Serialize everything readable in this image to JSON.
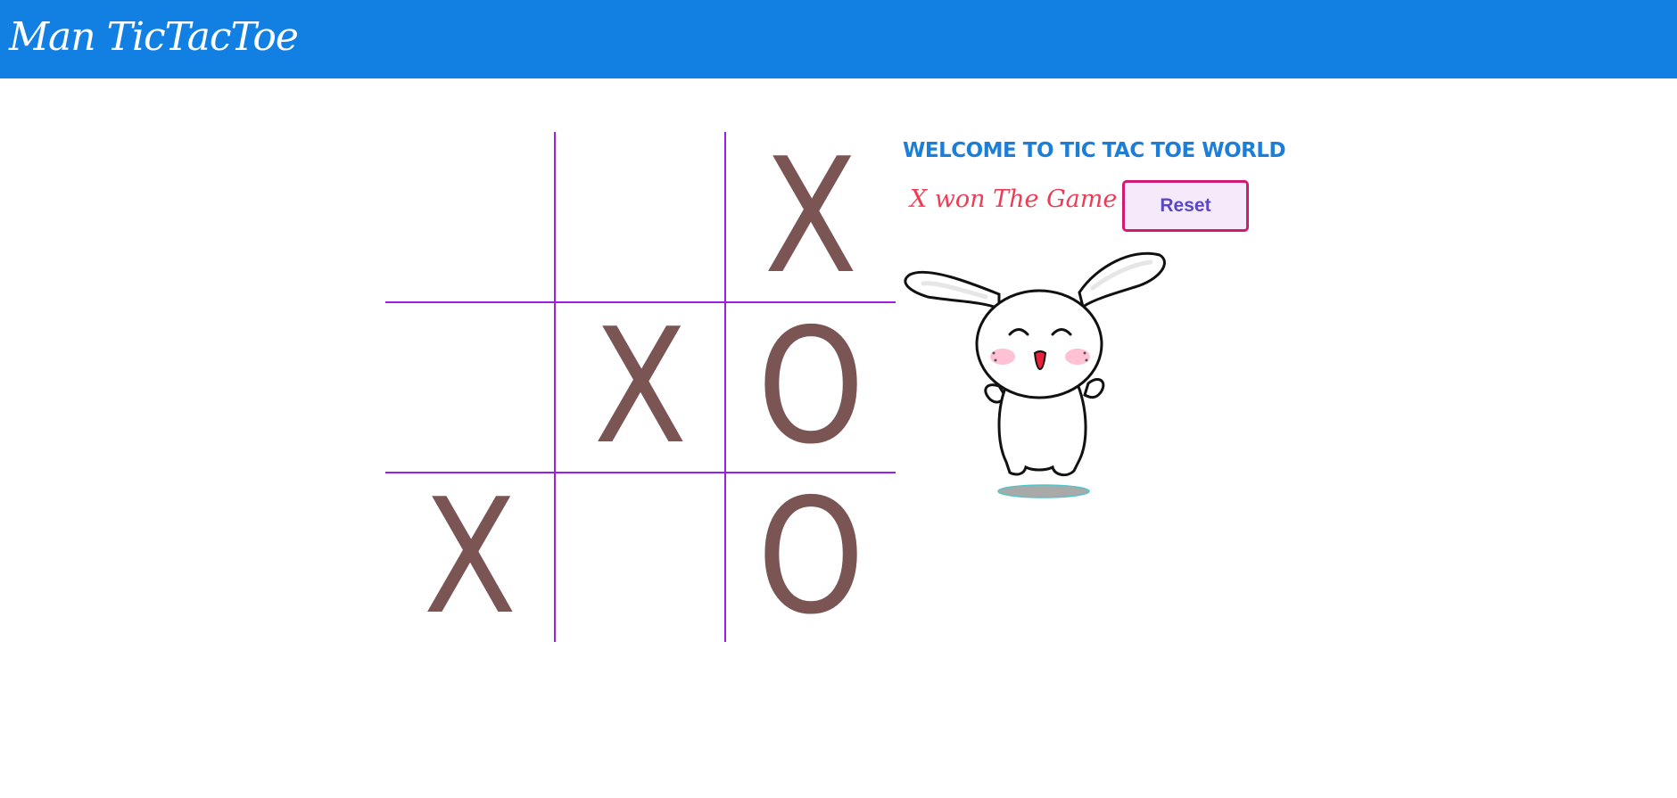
{
  "header": {
    "brand": "Man TicTacToe"
  },
  "board": {
    "cells": [
      {
        "mark": ""
      },
      {
        "mark": ""
      },
      {
        "mark": "X"
      },
      {
        "mark": ""
      },
      {
        "mark": "X"
      },
      {
        "mark": "O"
      },
      {
        "mark": "X"
      },
      {
        "mark": ""
      },
      {
        "mark": "O"
      }
    ]
  },
  "panel": {
    "title": "WELCOME TO TIC TAC TOE WORLD",
    "status": "X won The Game",
    "reset_label": "Reset"
  },
  "colors": {
    "navbar": "#1180e2",
    "mark": "#7b5454",
    "grid": "#9a1fe0",
    "title": "#1b7fd9",
    "status": "#ef3b55",
    "reset_border": "#d21a72",
    "reset_text": "#5a47c8"
  },
  "icons": {
    "mascot": "cheering-bunny-icon"
  }
}
